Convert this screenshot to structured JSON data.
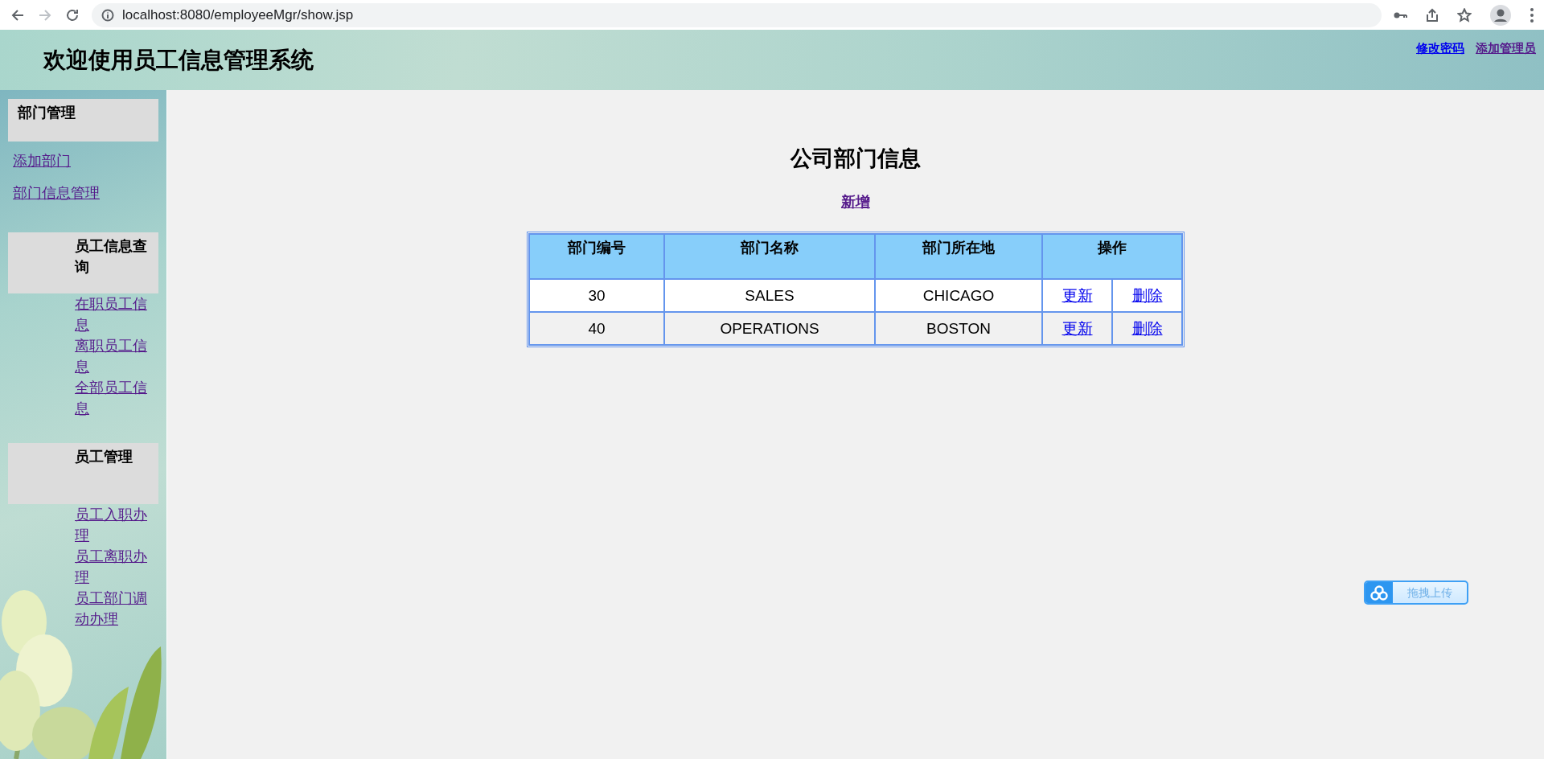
{
  "browser": {
    "url": "localhost:8080/employeeMgr/show.jsp"
  },
  "header": {
    "title": "欢迎使用员工信息管理系统",
    "links": [
      {
        "label": "修改密码",
        "visited": false
      },
      {
        "label": "添加管理员",
        "visited": true
      }
    ]
  },
  "sidebar": {
    "sections": [
      {
        "title": "部门管理",
        "indented": false,
        "items": [
          {
            "label": "添加部门",
            "visited": true
          },
          {
            "label": "部门信息管理",
            "visited": true
          }
        ]
      },
      {
        "title": "员工信息查询",
        "indented": true,
        "items": [
          {
            "label": "在职员工信息",
            "visited": true
          },
          {
            "label": "离职员工信息",
            "visited": true
          },
          {
            "label": "全部员工信息",
            "visited": true
          }
        ]
      },
      {
        "title": "员工管理",
        "indented": true,
        "items": [
          {
            "label": "员工入职办理",
            "visited": true
          },
          {
            "label": "员工离职办理",
            "visited": true
          },
          {
            "label": "员工部门调动办理",
            "visited": true
          }
        ]
      }
    ]
  },
  "main": {
    "title": "公司部门信息",
    "add_link": {
      "label": "新增",
      "visited": true
    },
    "table": {
      "columns": [
        "部门编号",
        "部门名称",
        "部门所在地",
        "操作"
      ],
      "rows": [
        {
          "cells": [
            "30",
            "SALES",
            "CHICAGO"
          ],
          "actions": [
            {
              "label": "更新",
              "visited": false
            },
            {
              "label": "删除",
              "visited": false
            }
          ]
        },
        {
          "cells": [
            "40",
            "OPERATIONS",
            "BOSTON"
          ],
          "actions": [
            {
              "label": "更新",
              "visited": false
            },
            {
              "label": "删除",
              "visited": false
            }
          ]
        }
      ]
    }
  },
  "upload_widget": {
    "label": "拖拽上传"
  }
}
